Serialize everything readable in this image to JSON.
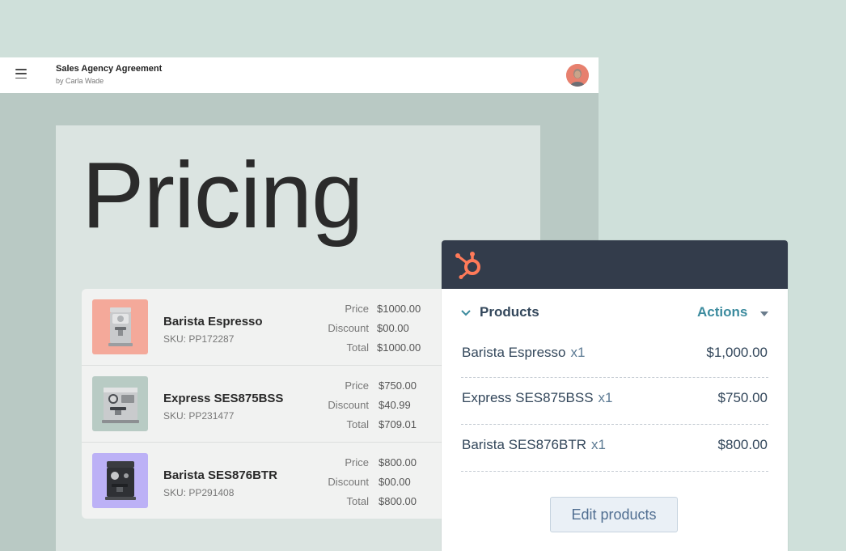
{
  "document": {
    "title": "Sales Agency Agreement",
    "author": "by Carla Wade",
    "heading": "Pricing"
  },
  "product_table": {
    "price_label": "Price",
    "discount_label": "Discount",
    "total_label": "Total",
    "rows": [
      {
        "name": "Barista Espresso",
        "sku": "SKU: PP172287",
        "price": "$1000.00",
        "discount": "$00.00",
        "total": "$1000.00",
        "thumb_color": "#f4a99a"
      },
      {
        "name": "Express SES875BSS",
        "sku": "SKU: PP231477",
        "price": "$750.00",
        "discount": "$40.99",
        "total": "$709.01",
        "thumb_color": "#b8cbc4"
      },
      {
        "name": "Barista SES876BTR",
        "sku": "SKU: PP291408",
        "price": "$800.00",
        "discount": "$00.00",
        "total": "$800.00",
        "thumb_color": "#bcb1f6"
      }
    ]
  },
  "hubspot": {
    "logo_icon": "hubspot-sprocket-icon",
    "section_title": "Products",
    "actions_label": "Actions",
    "line_items": [
      {
        "name": "Barista Espresso",
        "qty": "x1",
        "price": "$1,000.00"
      },
      {
        "name": "Express SES875BSS",
        "qty": "x1",
        "price": "$750.00"
      },
      {
        "name": "Barista SES876BTR",
        "qty": "x1",
        "price": "$800.00"
      }
    ],
    "edit_button": "Edit products"
  },
  "colors": {
    "background": "#cfe0da",
    "hubspot_header": "#333c4b",
    "hubspot_orange": "#ff7a59",
    "actions_teal": "#3c8b9e"
  }
}
